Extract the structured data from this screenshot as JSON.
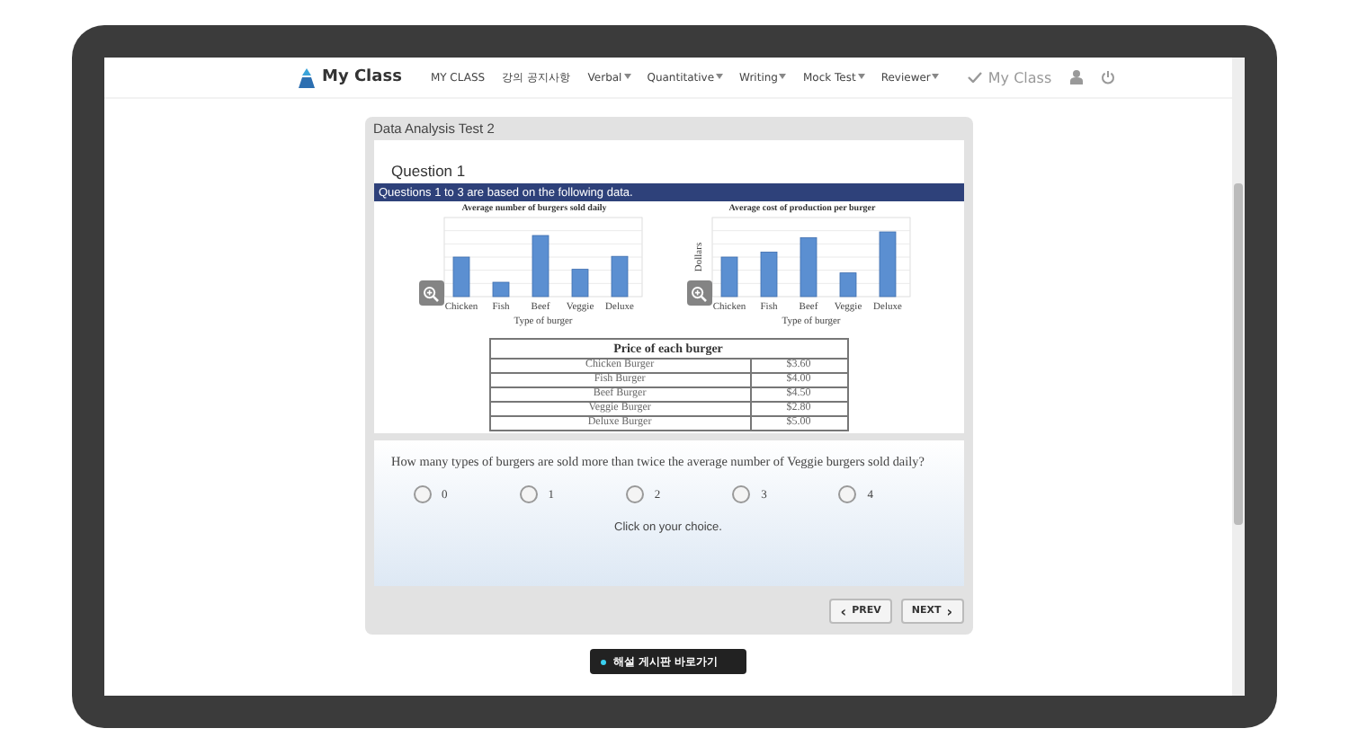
{
  "header": {
    "logo": "My Class",
    "nav": [
      {
        "label": "MY CLASS",
        "dropdown": false
      },
      {
        "label": "강의 공지사항",
        "dropdown": false
      },
      {
        "label": "Verbal",
        "dropdown": true
      },
      {
        "label": "Quantitative",
        "dropdown": true
      },
      {
        "label": "Writing",
        "dropdown": true
      },
      {
        "label": "Mock Test",
        "dropdown": true
      },
      {
        "label": "Reviewer",
        "dropdown": true
      }
    ],
    "account": "My Class"
  },
  "test": {
    "title": "Data Analysis Test 2",
    "question_number": "Question 1",
    "banner": "Questions 1 to 3 are based on the following data.",
    "charts": [
      {
        "title": "Average number of burgers sold daily",
        "categories": [
          "Chicken",
          "Fish",
          "Beef",
          "Veggie",
          "Deluxe"
        ],
        "xlabel": "Type of burger"
      },
      {
        "title": "Average cost of production per burger",
        "categories": [
          "Chicken",
          "Fish",
          "Beef",
          "Veggie",
          "Deluxe"
        ],
        "xlabel": "Type of burger",
        "ylabel": "Dollars"
      }
    ],
    "table": {
      "title": "Price of each burger",
      "rows": [
        [
          "Chicken Burger",
          "$3.60"
        ],
        [
          "Fish Burger",
          "$4.00"
        ],
        [
          "Beef Burger",
          "$4.50"
        ],
        [
          "Veggie Burger",
          "$2.80"
        ],
        [
          "Deluxe Burger",
          "$5.00"
        ]
      ]
    },
    "question": "How many types of burgers are sold more than twice the average number of Veggie burgers sold daily?",
    "options": [
      {
        "label": "0",
        "selected": false
      },
      {
        "label": "1",
        "selected": false
      },
      {
        "label": "2",
        "selected": false
      },
      {
        "label": "3",
        "selected": false
      },
      {
        "label": "4",
        "selected": false
      }
    ],
    "hint": "Click on your choice.",
    "prev": "PREV",
    "prev_icon": "‹",
    "next": "NEXT",
    "next_icon": "›"
  },
  "bottom_button": "해설 게시판 바로가기"
}
